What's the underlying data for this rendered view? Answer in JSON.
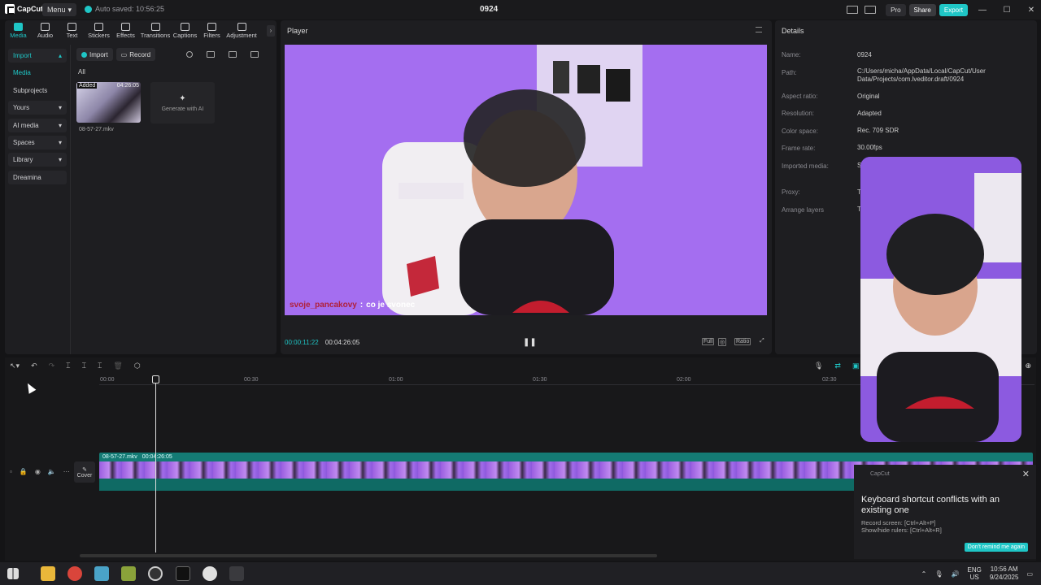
{
  "titlebar": {
    "logo": "CapCut",
    "menu_label": "Menu",
    "autosave": "Auto saved: 10:56:25",
    "project_title": "0924",
    "pro_label": "Pro",
    "share_label": "Share",
    "export_label": "Export"
  },
  "tools": [
    {
      "label": "Media"
    },
    {
      "label": "Audio"
    },
    {
      "label": "Text"
    },
    {
      "label": "Stickers"
    },
    {
      "label": "Effects"
    },
    {
      "label": "Transitions"
    },
    {
      "label": "Captions"
    },
    {
      "label": "Filters"
    },
    {
      "label": "Adjustment"
    }
  ],
  "sidebar": {
    "items": [
      {
        "label": "Import"
      },
      {
        "label": "Media"
      },
      {
        "label": "Subprojects"
      },
      {
        "label": "Yours"
      },
      {
        "label": "AI media"
      },
      {
        "label": "Spaces"
      },
      {
        "label": "Library"
      },
      {
        "label": "Dreamina"
      }
    ]
  },
  "media": {
    "import_label": "Import",
    "record_label": "Record",
    "all_label": "All",
    "thumb_badge": "Added",
    "thumb_duration": "04:26:05",
    "thumb_name": "08-57-27.mkv",
    "generate_ai": "Generate with AI"
  },
  "player": {
    "title": "Player",
    "subtitle_name": "svoje_pancakovy",
    "subtitle_text": "co je svonec",
    "time_current": "00:00:11:22",
    "time_total": "00:04:26:05",
    "full_label": "Full",
    "ratio_label": "Ratio"
  },
  "details": {
    "title": "Details",
    "rows": [
      {
        "label": "Name:",
        "value": "0924"
      },
      {
        "label": "Path:",
        "value": "C:/Users/micha/AppData/Local/CapCut/User Data/Projects/com.lveditor.draft/0924"
      },
      {
        "label": "Aspect ratio:",
        "value": "Original"
      },
      {
        "label": "Resolution:",
        "value": "Adapted"
      },
      {
        "label": "Color space:",
        "value": "Rec. 709 SDR"
      },
      {
        "label": "Frame rate:",
        "value": "30.00fps"
      },
      {
        "label": "Imported media:",
        "value": "St"
      },
      {
        "label": "Proxy:",
        "value": "T"
      },
      {
        "label": "Arrange layers",
        "value": "T"
      }
    ]
  },
  "timeline": {
    "ruler": [
      "00:00",
      "00:30",
      "01:00",
      "01:30",
      "02:00",
      "02:30"
    ],
    "clip_name": "08-57-27.mkv",
    "clip_duration": "00:04:26:05",
    "cover_label": "Cover"
  },
  "toast": {
    "app": "CapCut",
    "title": "Keyboard shortcut conflicts with an existing one",
    "line1": "Record screen: [Ctrl+Alt+P]",
    "line2": "Show/hide rulers: [Ctrl+Alt+R]",
    "button": "Don't remind me again"
  },
  "taskbar": {
    "lang1": "ENG",
    "lang2": "US",
    "time": "10:56 AM",
    "date": "9/24/2025"
  }
}
